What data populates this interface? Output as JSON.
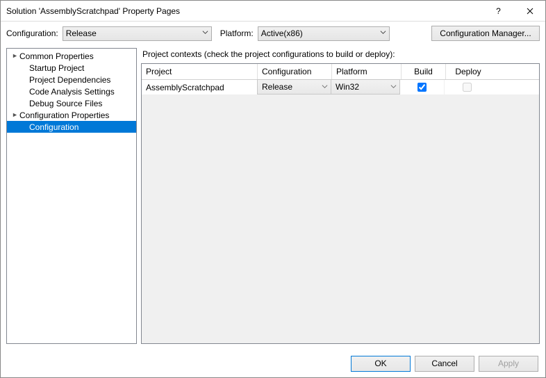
{
  "window": {
    "title": "Solution 'AssemblyScratchpad' Property Pages"
  },
  "toprow": {
    "config_label": "Configuration:",
    "config_value": "Release",
    "platform_label": "Platform:",
    "platform_value": "Active(x86)",
    "config_mgr": "Configuration Manager..."
  },
  "tree": {
    "root1": "Common Properties",
    "items1": [
      "Startup Project",
      "Project Dependencies",
      "Code Analysis Settings",
      "Debug Source Files"
    ],
    "root2": "Configuration Properties",
    "selected": "Configuration"
  },
  "grid": {
    "caption": "Project contexts (check the project configurations to build or deploy):",
    "headers": {
      "project": "Project",
      "config": "Configuration",
      "platform": "Platform",
      "build": "Build",
      "deploy": "Deploy"
    },
    "row": {
      "project": "AssemblyScratchpad",
      "config": "Release",
      "platform": "Win32",
      "build": true,
      "deploy": false
    }
  },
  "footer": {
    "ok": "OK",
    "cancel": "Cancel",
    "apply": "Apply"
  }
}
